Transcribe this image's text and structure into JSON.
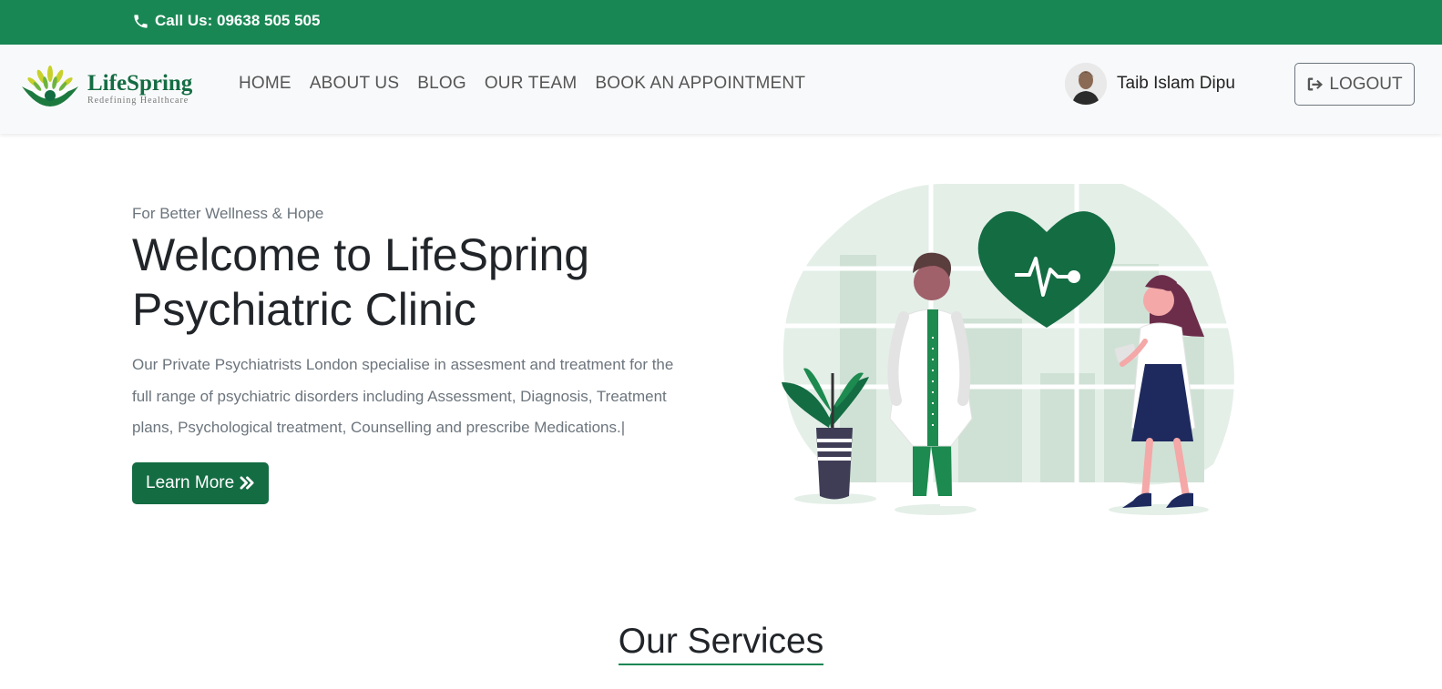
{
  "topbar": {
    "call_text": "Call Us: 09638 505 505",
    "icon": "phone-icon"
  },
  "brand": {
    "name": "LifeSpring",
    "tagline": "Redefining Healthcare"
  },
  "nav": {
    "items": [
      "HOME",
      "ABOUT US",
      "BLOG",
      "OUR TEAM",
      "BOOK AN APPOINTMENT"
    ]
  },
  "user": {
    "name": "Taib Islam Dipu"
  },
  "logout": {
    "label": "LOGOUT",
    "icon": "logout-icon"
  },
  "hero": {
    "eyebrow": "For Better Wellness & Hope",
    "title_line1": "Welcome to LifeSpring",
    "title_line2": "Psychiatric Clinic",
    "description": "Our Private Psychiatrists London specialise in assesment and treatment for the full range of psychiatric disorders including Assessment, Diagnosis, Treatment plans, Psychological treatment, Counselling and prescribe Medications.|",
    "cta_label": "Learn More",
    "cta_icon": "double-chevron-right-icon"
  },
  "services": {
    "heading": "Our Services"
  },
  "colors": {
    "primary": "#198754",
    "dark_green": "#146c43",
    "nav_bg": "#f8f9fa",
    "text_muted": "#6c757d"
  }
}
